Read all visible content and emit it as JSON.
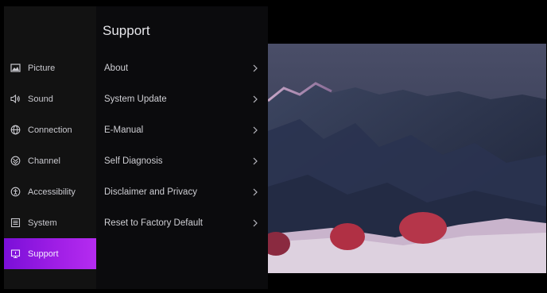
{
  "sidebar": {
    "items": [
      {
        "label": "Picture",
        "icon": "picture-icon",
        "active": false
      },
      {
        "label": "Sound",
        "icon": "speaker-icon",
        "active": false
      },
      {
        "label": "Connection",
        "icon": "globe-icon",
        "active": false
      },
      {
        "label": "Channel",
        "icon": "channel-icon",
        "active": false
      },
      {
        "label": "Accessibility",
        "icon": "accessibility-icon",
        "active": false
      },
      {
        "label": "System",
        "icon": "system-icon",
        "active": false
      },
      {
        "label": "Support",
        "icon": "support-icon",
        "active": true
      }
    ]
  },
  "panel": {
    "title": "Support",
    "items": [
      {
        "label": "About"
      },
      {
        "label": "System Update"
      },
      {
        "label": "E-Manual"
      },
      {
        "label": "Self Diagnosis"
      },
      {
        "label": "Disclaimer and Privacy"
      },
      {
        "label": "Reset to Factory Default"
      }
    ]
  },
  "colors": {
    "accent": "#9b1de6",
    "background": "#000000",
    "sidebar": "#121212",
    "panel": "#0b0b0d"
  }
}
